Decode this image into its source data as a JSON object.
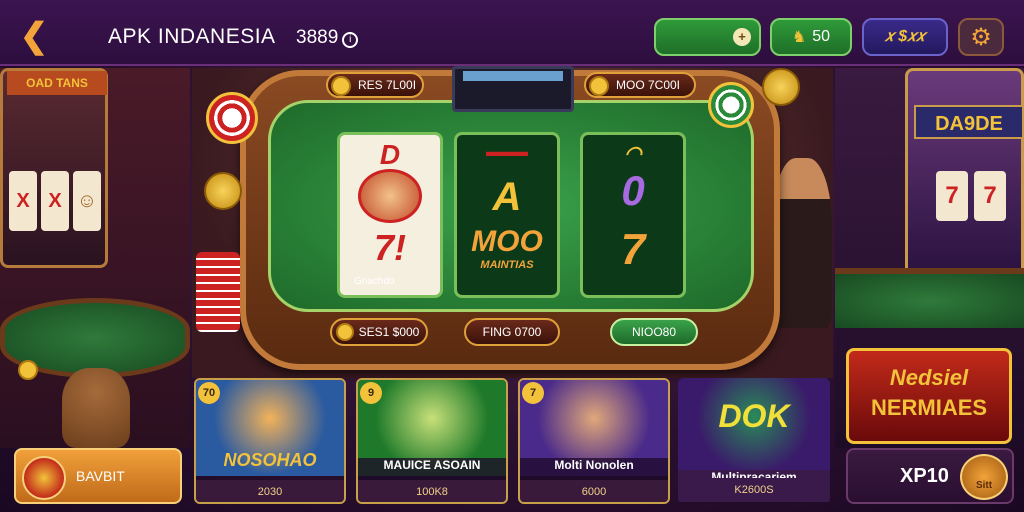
{
  "header": {
    "title": "APK INDANESIA",
    "code": "3889",
    "code_icon": "ⓘ",
    "balance_icon": "+",
    "points_label": "50",
    "points_icon": "♞",
    "vip_label": "𝑥 $𝑥𝑥",
    "settings_icon": "gear-icon"
  },
  "machine": {
    "top_left_label": "RES 7L00I",
    "top_right_label": "MOO 7C00I",
    "reel1_top": "D",
    "reel1_bottom": "7!",
    "reel1_caption": "Gnachdo",
    "reel2_top": "A",
    "reel2_mid": "MOO",
    "reel2_sub": "MAINTIAS",
    "reel3_top": "0",
    "reel3_bottom": "7",
    "btn_left": "SES1 $000",
    "btn_mid": "FING  0700",
    "btn_right": "NIOO80"
  },
  "side": {
    "left_marquee": "OAD TANS",
    "right_marquee": "DA9DE"
  },
  "cards": [
    {
      "num": "70",
      "logo": "NOSOHAO",
      "sub": "2030"
    },
    {
      "num": "9",
      "logo": "",
      "name": "MAUICE ASOAIN",
      "sub": "100K8"
    },
    {
      "num": "7",
      "logo": "",
      "name": "Molti  Nonolen",
      "sub": "6000"
    },
    {
      "num": "",
      "logo": "DOK",
      "name": "Multipracariem",
      "sub": "K2600S"
    }
  ],
  "feature": {
    "line1": "Nedsiel",
    "line2": "NERMIAES"
  },
  "bottom": {
    "left_label": "BAVBIT",
    "right_label": "XP10",
    "right_icon_caption": "Sitt"
  }
}
